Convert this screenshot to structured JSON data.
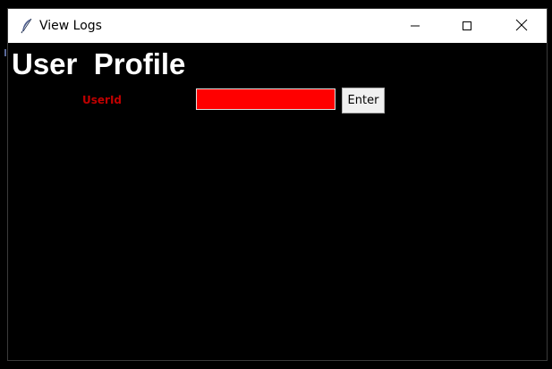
{
  "window": {
    "title": "View Logs",
    "app_icon": "feather-icon",
    "controls": {
      "minimize_icon": "minimize-icon",
      "maximize_icon": "maximize-icon",
      "close_icon": "close-icon"
    }
  },
  "main": {
    "heading": "User  Profile",
    "userid_label": "UserId",
    "userid_value": "",
    "enter_label": "Enter"
  },
  "colors": {
    "background": "#000000",
    "heading": "#ffffff",
    "label": "#c00000",
    "input_fill": "#ff0000",
    "button_face": "#f0f0f0"
  }
}
